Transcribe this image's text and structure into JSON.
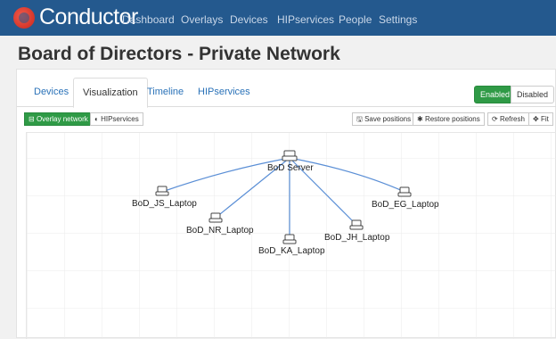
{
  "navbar": {
    "brand": "Conductor",
    "items": [
      "Dashboard",
      "Overlays",
      "Devices",
      "HIPservices",
      "People",
      "Settings"
    ]
  },
  "page": {
    "title": "Board of Directors - Private Network"
  },
  "tabs": [
    "Devices",
    "Visualization",
    "Timeline",
    "HIPservices"
  ],
  "active_tab": "Visualization",
  "toggle": {
    "enabled": "Enabled",
    "disabled": "Disabled",
    "state": "Enabled"
  },
  "toolbar": {
    "overlay_network": "Overlay network",
    "hipservices": "HIPservices",
    "save_positions": "Save positions",
    "restore_positions": "Restore positions",
    "refresh": "Refresh",
    "fit": "Fit"
  },
  "graph": {
    "server": "BoD Server",
    "laptops": [
      "BoD_JS_Laptop",
      "BoD_NR_Laptop",
      "BoD_KA_Laptop",
      "BoD_JH_Laptop",
      "BoD_EG_Laptop"
    ]
  },
  "colors": {
    "navbar": "#24598e",
    "accent_green": "#2f9a46",
    "edge": "#5b8fd6",
    "link": "#2a72b8"
  }
}
